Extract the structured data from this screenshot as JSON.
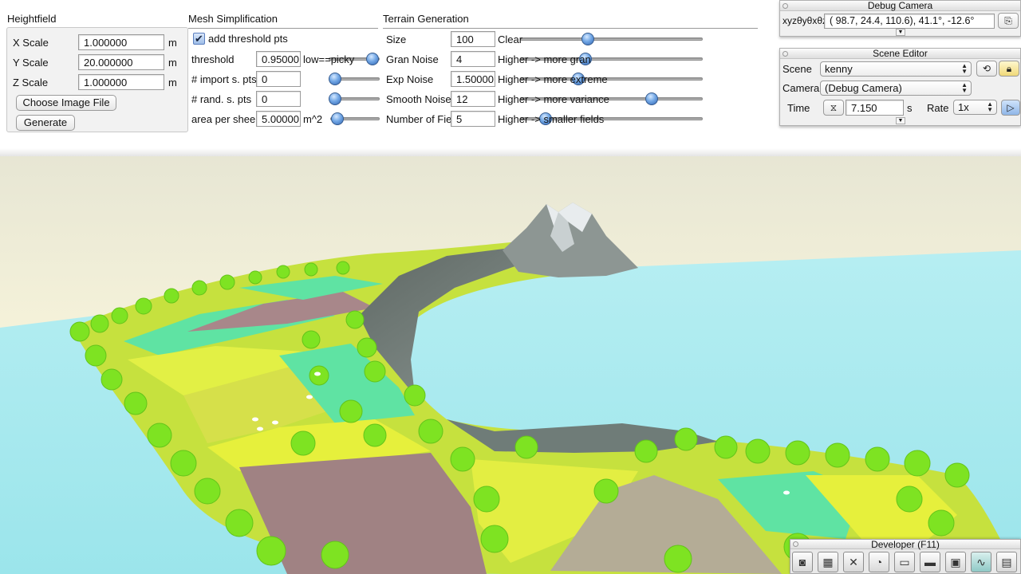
{
  "heightfield": {
    "title": "Heightfield",
    "x_label": "X Scale",
    "x_value": "1.000000",
    "x_unit": "m",
    "y_label": "Y Scale",
    "y_value": "20.000000",
    "y_unit": "m",
    "z_label": "Z Scale",
    "z_value": "1.000000",
    "z_unit": "m",
    "choose_button": "Choose Image File",
    "generate_button": "Generate"
  },
  "mesh": {
    "title": "Mesh Simplification",
    "add_threshold_label": "add threshold pts",
    "add_threshold_checked": true,
    "threshold_label": "threshold",
    "threshold_value": "0.95000",
    "threshold_hint": "low==picky",
    "import_label": "# import s. pts",
    "import_value": "0",
    "rand_label": "# rand. s. pts",
    "rand_value": "0",
    "sheep_label": "area per sheep",
    "sheep_value": "5.00000",
    "sheep_unit": "m^2"
  },
  "terrain": {
    "title": "Terrain Generation",
    "size_label": "Size",
    "size_value": "100",
    "size_hint": "Clear",
    "gran_label": "Gran Noise",
    "gran_value": "4",
    "gran_hint": "Higher -> more gran",
    "exp_label": "Exp Noise",
    "exp_value": "1.50000",
    "exp_hint": "Higher -> more extreme",
    "smooth_label": "Smooth Noise",
    "smooth_value": "12",
    "smooth_hint": "Higher -> more variance",
    "fields_label": "Number of Fields",
    "fields_value": "5",
    "fields_hint": "Higher -> smaller fields"
  },
  "debug_camera": {
    "title": "Debug Camera",
    "xyz_label": "xyzθyθxθz",
    "coords": "( 98.7,  24.4,  110.6),  41.1°, -12.6°"
  },
  "scene_editor": {
    "title": "Scene Editor",
    "scene_label": "Scene",
    "scene_value": "kenny",
    "camera_label": "Camera",
    "camera_value": "(Debug Camera)",
    "time_label": "Time",
    "time_value": "7.150",
    "time_unit": "s",
    "rate_label": "Rate",
    "rate_value": "1x"
  },
  "developer": {
    "title": "Developer (F11)",
    "tools": [
      "camera-icon",
      "clapperboard-icon",
      "wrench-icon",
      "clock-icon",
      "window-icon",
      "terminal-icon",
      "scene-graph-icon",
      "profiler-icon",
      "document-icon"
    ]
  },
  "colors": {
    "sky_top": "#ecebd9",
    "water": "#a6eaee",
    "grass_yellow": "#d6ec3a",
    "grass_green": "#5fe3a3",
    "field_red": "#a08283",
    "tree": "#7ee322",
    "rock": "#7e8a86",
    "snow": "#e8ecee",
    "slider_knob": "#4b84d0"
  }
}
